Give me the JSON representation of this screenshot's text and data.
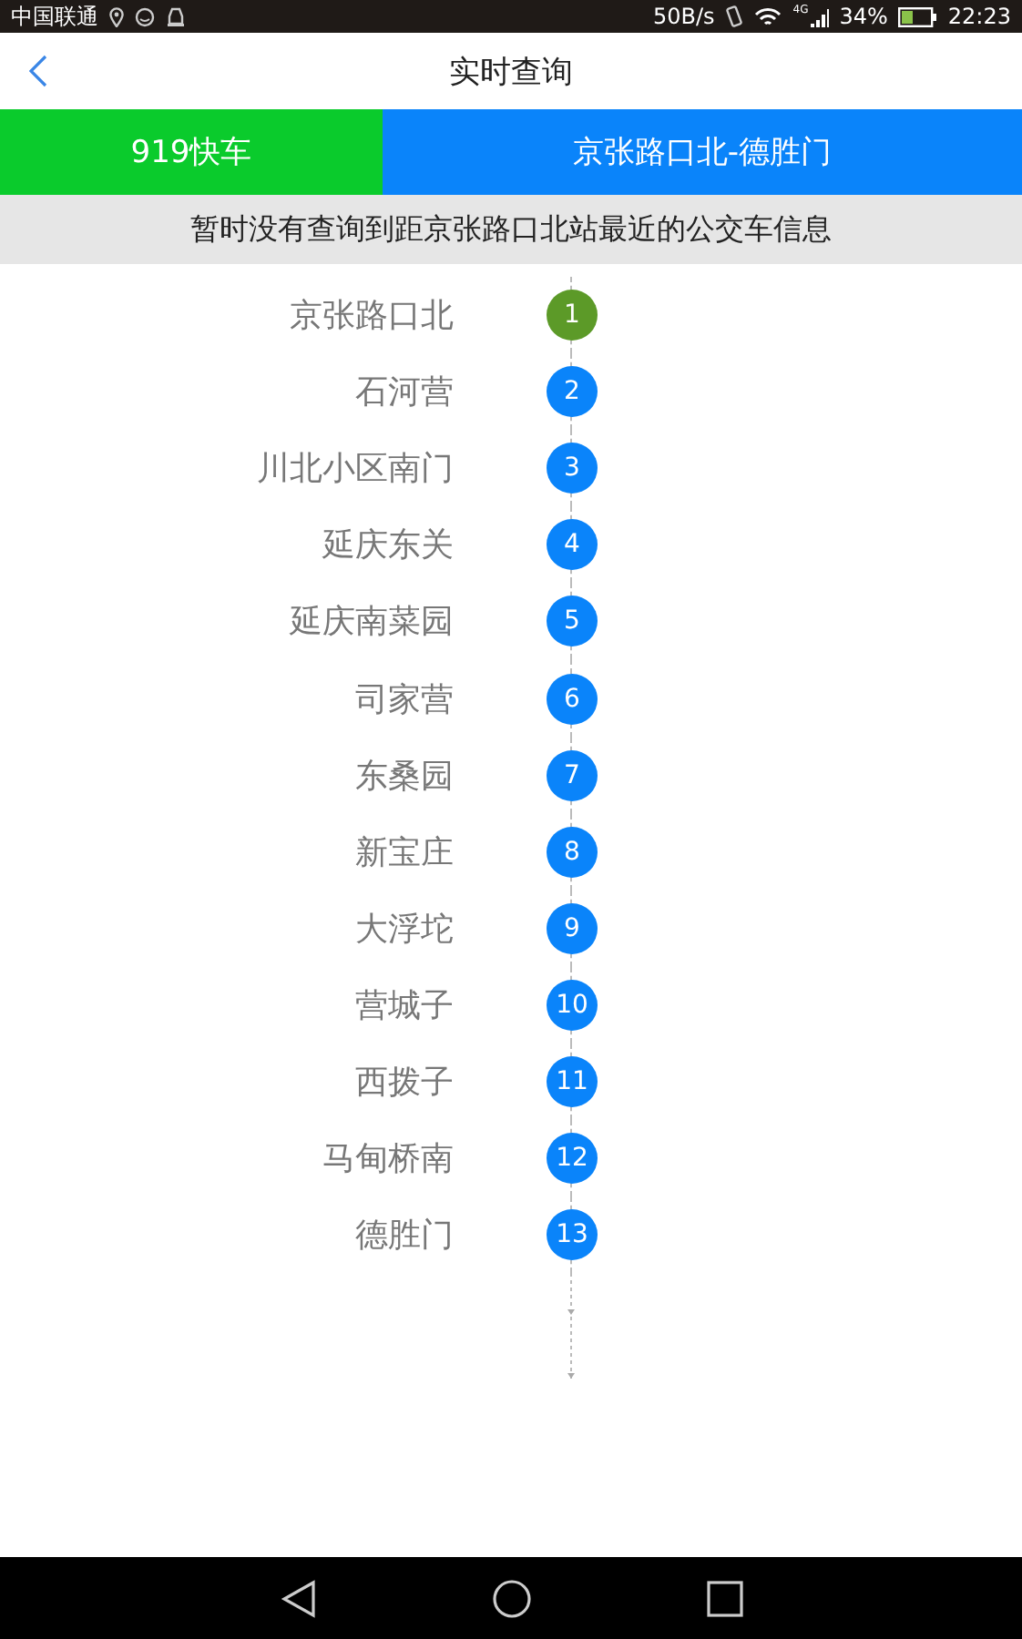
{
  "status_bar": {
    "carrier": "中国联通",
    "speed": "50B/s",
    "network": "4G",
    "battery": "34%",
    "time": "22:23"
  },
  "header": {
    "title": "实时查询"
  },
  "route": {
    "line": "919快车",
    "direction": "京张路口北-德胜门"
  },
  "notice": "暂时没有查询到距京张路口北站最近的公交车信息",
  "stops": [
    {
      "name": "京张路口北",
      "number": "1",
      "selected": true
    },
    {
      "name": "石河营",
      "number": "2",
      "selected": false
    },
    {
      "name": "川北小区南门",
      "number": "3",
      "selected": false
    },
    {
      "name": "延庆东关",
      "number": "4",
      "selected": false
    },
    {
      "name": "延庆南菜园",
      "number": "5",
      "selected": false
    },
    {
      "name": "司家营",
      "number": "6",
      "selected": false
    },
    {
      "name": "东桑园",
      "number": "7",
      "selected": false
    },
    {
      "name": "新宝庄",
      "number": "8",
      "selected": false
    },
    {
      "name": "大浮坨",
      "number": "9",
      "selected": false
    },
    {
      "name": "营城子",
      "number": "10",
      "selected": false
    },
    {
      "name": "西拨子",
      "number": "11",
      "selected": false
    },
    {
      "name": "马甸桥南",
      "number": "12",
      "selected": false
    },
    {
      "name": "德胜门",
      "number": "13",
      "selected": false
    }
  ]
}
